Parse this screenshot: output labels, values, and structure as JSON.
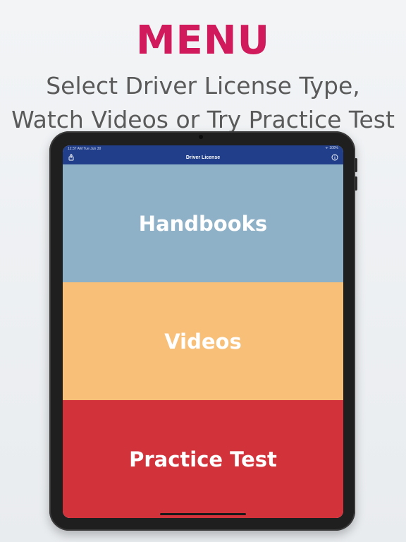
{
  "promo": {
    "headline": "MENU",
    "subtitle_line1": "Select Driver License Type,",
    "subtitle_line2": "Watch Videos or Try Practice Test"
  },
  "status_bar": {
    "time": "12:37 AM  Tue Jun 30",
    "right": "ᯤ 100%"
  },
  "navbar": {
    "title": "Driver License",
    "left_icon": "share-icon",
    "right_icon": "info-icon"
  },
  "menu": {
    "items": [
      {
        "label": "Handbooks"
      },
      {
        "label": "Videos"
      },
      {
        "label": "Practice Test"
      }
    ]
  },
  "colors": {
    "headline": "#d11a5b",
    "navbar": "#213e8a",
    "handbooks": "#8eb1c7",
    "videos": "#f8bf79",
    "practice_test": "#d2333b"
  }
}
